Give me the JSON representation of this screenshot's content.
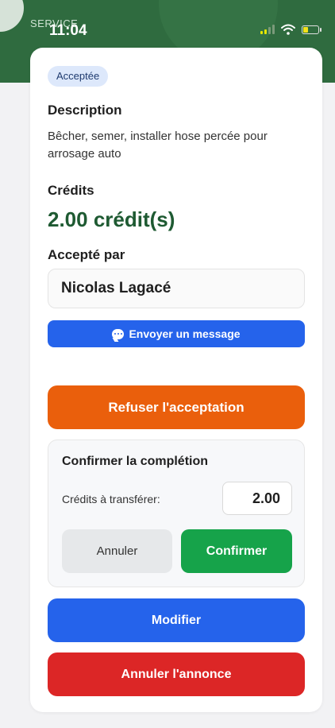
{
  "status_bar": {
    "carrier": "SERVICE",
    "time": "11:04"
  },
  "colors": {
    "header_green": "#2f6b3f",
    "badge_bg": "#dde8fb",
    "credits_green": "#1e5a32",
    "primary_blue": "#2563eb",
    "refuse_orange": "#ea5f0c",
    "confirm_green": "#16a34a",
    "danger_red": "#dc2626"
  },
  "request": {
    "status_badge": "Acceptée",
    "description_label": "Description",
    "description_text": "Bêcher, semer, installer hose percée pour arrosage auto",
    "credits_label": "Crédits",
    "credits_value": "2.00 crédit(s)",
    "accepted_by_label": "Accepté par",
    "accepted_by_name": "Nicolas Lagacé",
    "message_button": "Envoyer un message",
    "refuse_button": "Refuser l'acceptation"
  },
  "completion": {
    "title": "Confirmer la complétion",
    "transfer_label": "Crédits à transférer:",
    "transfer_value": "2.00",
    "cancel_button": "Annuler",
    "confirm_button": "Confirmer"
  },
  "actions": {
    "modify_button": "Modifier",
    "cancel_ad_button": "Annuler l'annonce"
  },
  "icons": [
    "signal-icon",
    "wifi-icon",
    "battery-icon",
    "chat-bubble-icon"
  ]
}
